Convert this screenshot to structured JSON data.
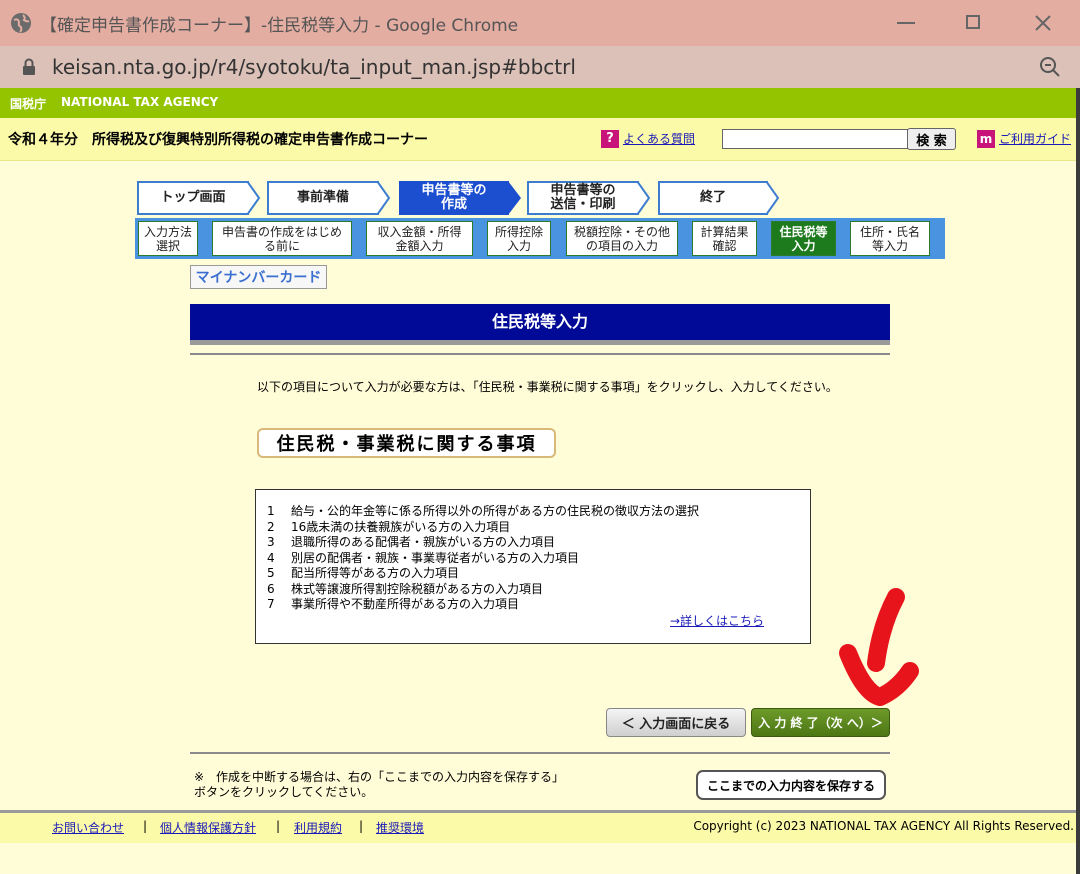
{
  "browser": {
    "window_title": "【確定申告書作成コーナー】-住民税等入力 - Google Chrome",
    "url": "keisan.nta.go.jp/r4/syotoku/ta_input_man.jsp#bbctrl"
  },
  "agency": {
    "name_jp": "国税庁",
    "name_en": "NATIONAL TAX AGENCY"
  },
  "header": {
    "title": "令和４年分　所得税及び復興特別所得税の確定申告書作成コーナー",
    "faq_label": "よくある質問",
    "search_placeholder": "",
    "search_button": "検 索",
    "guide_label": "ご利用ガイド"
  },
  "steps": [
    {
      "label": "トップ画面"
    },
    {
      "label": "事前準備"
    },
    {
      "label": "申告書等の\n作成"
    },
    {
      "label": "申告書等の\n送信・印刷"
    },
    {
      "label": "終了"
    }
  ],
  "substeps": [
    {
      "label": "入力方法\n選択"
    },
    {
      "label": "申告書の作成をはじめ\nる前に"
    },
    {
      "label": "収入金額・所得\n金額入力"
    },
    {
      "label": "所得控除\n入力"
    },
    {
      "label": "税額控除・その他\nの項目の入力"
    },
    {
      "label": "計算結果\n確認"
    },
    {
      "label": "住民税等\n入力"
    },
    {
      "label": "住所・氏名\n等入力"
    }
  ],
  "mynumber_tab": "マイナンバーカード",
  "page_title": "住民税等入力",
  "instruction": "以下の項目について入力が必要な方は、「住民税・事業税に関する事項」をクリックし、入力してください。",
  "section_button": "住民税・事業税に関する事項",
  "items": [
    {
      "num": "1",
      "text": "給与・公的年金等に係る所得以外の所得がある方の住民税の徴収方法の選択"
    },
    {
      "num": "2",
      "text": "16歳未満の扶養親族がいる方の入力項目"
    },
    {
      "num": "3",
      "text": "退職所得のある配偶者・親族がいる方の入力項目"
    },
    {
      "num": "4",
      "text": "別居の配偶者・親族・事業専従者がいる方の入力項目"
    },
    {
      "num": "5",
      "text": "配当所得等がある方の入力項目"
    },
    {
      "num": "6",
      "text": "株式等譲渡所得割控除税額がある方の入力項目"
    },
    {
      "num": "7",
      "text": "事業所得や不動産所得がある方の入力項目"
    }
  ],
  "details_link": "→詳しくはこちら",
  "back_button": "＜ 入力画面に戻る",
  "next_button": "入 力 終 了（次 へ）＞",
  "save_note": "※　作成を中断する場合は、右の「ここまでの入力内容を保存する」ボタンをクリックしてください。",
  "save_button": "ここまでの入力内容を保存する",
  "footer": {
    "links": [
      "お問い合わせ",
      "個人情報保護方針",
      "利用規約",
      "推奨環境"
    ],
    "copyright": "Copyright (c) 2023 NATIONAL TAX AGENCY All Rights Reserved."
  },
  "colors": {
    "title_bar": "#e4ada2",
    "nta_green": "#94c400",
    "header_yellow": "#fbfaa8",
    "page_bg": "#fffcd8",
    "heading_navy": "#000a96",
    "annotation_red": "#e8141c"
  }
}
